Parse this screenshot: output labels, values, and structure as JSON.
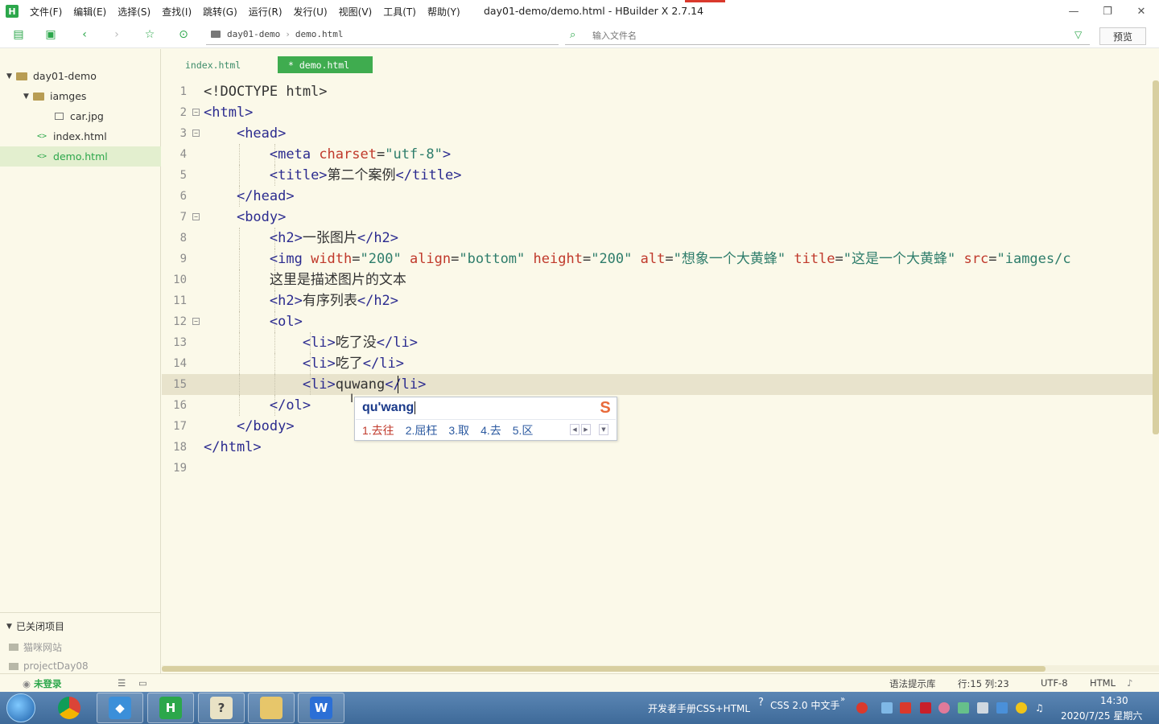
{
  "app": {
    "logo": "H",
    "window_title": "day01-demo/demo.html - HBuilder X 2.7.14",
    "menu": [
      "文件(F)",
      "编辑(E)",
      "选择(S)",
      "查找(I)",
      "跳转(G)",
      "运行(R)",
      "发行(U)",
      "视图(V)",
      "工具(T)",
      "帮助(Y)"
    ],
    "window_controls": {
      "minimize": "—",
      "restore": "❐",
      "close": "✕"
    }
  },
  "toolbar": {
    "breadcrumb": [
      "day01-demo",
      "demo.html"
    ],
    "breadcrumb_sep": "›",
    "search_placeholder": "输入文件名",
    "preview_label": "预览"
  },
  "sidebar": {
    "tree": [
      {
        "label": "day01-demo",
        "type": "folder"
      },
      {
        "label": "iamges",
        "type": "folder"
      },
      {
        "label": "car.jpg",
        "type": "image"
      },
      {
        "label": "index.html",
        "type": "html"
      },
      {
        "label": "demo.html",
        "type": "html",
        "selected": true
      }
    ],
    "closed_header": "已关闭项目",
    "closed_projects": [
      "猫咪网站",
      "projectDay08"
    ]
  },
  "tabs": [
    {
      "label": "index.html",
      "active": false
    },
    {
      "label": "* demo.html",
      "active": true
    }
  ],
  "editor": {
    "line_numbers": [
      "1",
      "2",
      "3",
      "4",
      "5",
      "6",
      "7",
      "8",
      "9",
      "10",
      "11",
      "12",
      "13",
      "14",
      "15",
      "16",
      "17",
      "18",
      "19"
    ],
    "current_line": 15,
    "lines": [
      [
        [
          "tx",
          "<!DOCTYPE html>"
        ]
      ],
      [
        [
          "tg",
          "<html>"
        ]
      ],
      [
        [
          "tx",
          "    "
        ],
        [
          "tg",
          "<head>"
        ]
      ],
      [
        [
          "tx",
          "        "
        ],
        [
          "tg",
          "<meta "
        ],
        [
          "at",
          "charset"
        ],
        [
          "tx",
          "="
        ],
        [
          "st",
          "\"utf-8\""
        ],
        [
          "tg",
          ">"
        ]
      ],
      [
        [
          "tx",
          "        "
        ],
        [
          "tg",
          "<title>"
        ],
        [
          "tx",
          "第二个案例"
        ],
        [
          "tg",
          "</title>"
        ]
      ],
      [
        [
          "tx",
          "    "
        ],
        [
          "tg",
          "</head>"
        ]
      ],
      [
        [
          "tx",
          "    "
        ],
        [
          "tg",
          "<body>"
        ]
      ],
      [
        [
          "tx",
          "        "
        ],
        [
          "tg",
          "<h2>"
        ],
        [
          "tx",
          "一张图片"
        ],
        [
          "tg",
          "</h2>"
        ]
      ],
      [
        [
          "tx",
          "        "
        ],
        [
          "tg",
          "<img "
        ],
        [
          "at",
          "width"
        ],
        [
          "tx",
          "="
        ],
        [
          "st",
          "\"200\""
        ],
        [
          "tx",
          " "
        ],
        [
          "at",
          "align"
        ],
        [
          "tx",
          "="
        ],
        [
          "st",
          "\"bottom\""
        ],
        [
          "tx",
          " "
        ],
        [
          "at",
          "height"
        ],
        [
          "tx",
          "="
        ],
        [
          "st",
          "\"200\""
        ],
        [
          "tx",
          " "
        ],
        [
          "at",
          "alt"
        ],
        [
          "tx",
          "="
        ],
        [
          "st",
          "\"想象一个大黄蜂\""
        ],
        [
          "tx",
          " "
        ],
        [
          "at",
          "title"
        ],
        [
          "tx",
          "="
        ],
        [
          "st",
          "\"这是一个大黄蜂\""
        ],
        [
          "tx",
          " "
        ],
        [
          "at",
          "src"
        ],
        [
          "tx",
          "="
        ],
        [
          "st",
          "\"iamges/c"
        ]
      ],
      [
        [
          "tx",
          "        这里是描述图片的文本"
        ]
      ],
      [
        [
          "tx",
          "        "
        ],
        [
          "tg",
          "<h2>"
        ],
        [
          "tx",
          "有序列表"
        ],
        [
          "tg",
          "</h2>"
        ]
      ],
      [
        [
          "tx",
          "        "
        ],
        [
          "tg",
          "<ol>"
        ]
      ],
      [
        [
          "tx",
          "            "
        ],
        [
          "tg",
          "<li>"
        ],
        [
          "tx",
          "吃了没"
        ],
        [
          "tg",
          "</li>"
        ]
      ],
      [
        [
          "tx",
          "            "
        ],
        [
          "tg",
          "<li>"
        ],
        [
          "tx",
          "吃了"
        ],
        [
          "tg",
          "</li>"
        ]
      ],
      [
        [
          "tx",
          "            "
        ],
        [
          "tg",
          "<li>"
        ],
        [
          "tx",
          "quwang"
        ],
        [
          "tg",
          "</li>"
        ]
      ],
      [
        [
          "tx",
          "        "
        ],
        [
          "tg",
          "</ol>"
        ]
      ],
      [
        [
          "tx",
          "    "
        ],
        [
          "tg",
          "</body>"
        ]
      ],
      [
        [
          "tg",
          "</html>"
        ]
      ],
      [
        [
          "tx",
          ""
        ]
      ]
    ]
  },
  "ime": {
    "composition": "qu'wang",
    "candidates": [
      "1.去往",
      "2.屈枉",
      "3.取",
      "4.去",
      "5.区"
    ],
    "logo": "S"
  },
  "statusbar": {
    "login": "未登录",
    "syntax_lib": "语法提示库",
    "position": "行:15  列:23",
    "encoding": "UTF-8",
    "language": "HTML"
  },
  "taskbar": {
    "tray_text_1": "开发者手册CSS+HTML",
    "tray_text_2": "CSS 2.0 中文手",
    "time": "14:30",
    "date": "2020/7/25 星期六"
  },
  "colors": {
    "accent": "#2ca74b",
    "editor_bg": "#fbf9e9",
    "tag": "#2b2b8f",
    "attr": "#c0392b",
    "string": "#2e7d6b"
  }
}
